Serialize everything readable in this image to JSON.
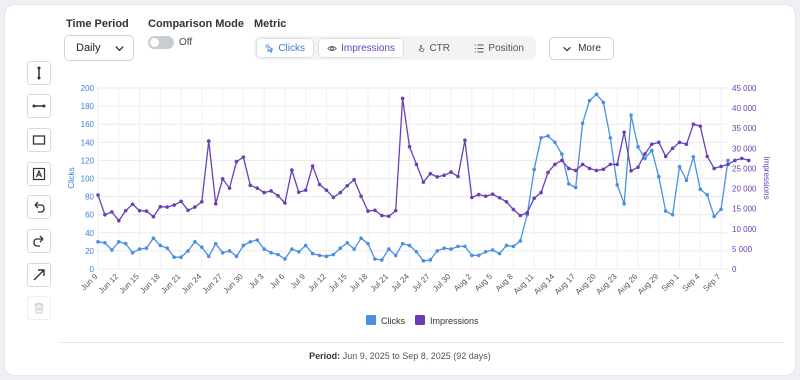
{
  "controls": {
    "time_period_label": "Time Period",
    "time_period_value": "Daily",
    "comparison_label": "Comparison Mode",
    "comparison_state": "Off",
    "metric_label": "Metric",
    "metrics": [
      {
        "label": "Clicks",
        "icon": "cursor-click-icon",
        "active": true
      },
      {
        "label": "Impressions",
        "icon": "eye-icon",
        "active": true
      },
      {
        "label": "CTR",
        "icon": "pointer-icon",
        "active": false
      },
      {
        "label": "Position",
        "icon": "list-icon",
        "active": false
      }
    ],
    "more_label": "More"
  },
  "toolbar": [
    "vertical-line-tool-icon",
    "horizontal-line-tool-icon",
    "rectangle-tool-icon",
    "text-box-tool-icon",
    "undo-icon",
    "redo-icon",
    "arrow-tool-icon",
    "trash-icon"
  ],
  "footer": {
    "period_label": "Period:",
    "period_text": "Jun 9, 2025 to Sep 8, 2025 (92 days)"
  },
  "colors": {
    "clicks": "#4a90e2",
    "impressions": "#6a3fb5",
    "accent": "#3b7dd8"
  },
  "chart_data": {
    "type": "line",
    "x_ticks": [
      "Jun 9",
      "Jun 12",
      "Jun 15",
      "Jun 18",
      "Jun 21",
      "Jun 24",
      "Jun 27",
      "Jun 30",
      "Jul 3",
      "Jul 6",
      "Jul 9",
      "Jul 12",
      "Jul 15",
      "Jul 18",
      "Jul 21",
      "Jul 24",
      "Jul 27",
      "Jul 30",
      "Aug 2",
      "Aug 5",
      "Aug 8",
      "Aug 11",
      "Aug 14",
      "Aug 17",
      "Aug 20",
      "Aug 23",
      "Aug 26",
      "Aug 29",
      "Sep 1",
      "Sep 4",
      "Sep 7"
    ],
    "y_left": {
      "label": "Clicks",
      "min": 0,
      "max": 200,
      "ticks": [
        "0",
        "20",
        "40",
        "60",
        "80",
        "100",
        "120",
        "140",
        "160",
        "180",
        "200"
      ]
    },
    "y_right": {
      "label": "Impressions",
      "min": 0,
      "max": 45000,
      "ticks": [
        "0",
        "5 000",
        "10 000",
        "15 000",
        "20 000",
        "25 000",
        "30 000",
        "35 000",
        "40 000",
        "45 000"
      ]
    },
    "series": [
      {
        "name": "Clicks",
        "axis": "left",
        "values": [
          30,
          29,
          21,
          30,
          28,
          18,
          22,
          23,
          34,
          26,
          23,
          13,
          13,
          20,
          30,
          24,
          14,
          28,
          18,
          20,
          14,
          26,
          30,
          32,
          22,
          18,
          16,
          11,
          22,
          19,
          26,
          17,
          15,
          14,
          16,
          23,
          29,
          22,
          34,
          28,
          11,
          10,
          22,
          15,
          28,
          26,
          19,
          9,
          10,
          20,
          23,
          22,
          25,
          25,
          15,
          15,
          19,
          21,
          17,
          26,
          25,
          31,
          60,
          110,
          145,
          147,
          140,
          127,
          94,
          90,
          161,
          186,
          193,
          184,
          145,
          93,
          72,
          170,
          135,
          122,
          131,
          102,
          64,
          60,
          113,
          98,
          124,
          88,
          82,
          58,
          66,
          120
        ]
      },
      {
        "name": "Impressions",
        "axis": "right",
        "values": [
          18400,
          13500,
          14200,
          12000,
          14500,
          16100,
          14500,
          14400,
          13000,
          15500,
          15400,
          15900,
          16800,
          14600,
          15400,
          16700,
          31800,
          16200,
          22400,
          20100,
          26700,
          27800,
          20800,
          20100,
          19000,
          19400,
          18200,
          16400,
          24600,
          19100,
          19600,
          25600,
          21000,
          19600,
          17800,
          19000,
          20700,
          22200,
          18100,
          14400,
          14600,
          13300,
          13100,
          14500,
          42400,
          30400,
          26000,
          21600,
          23700,
          22900,
          23300,
          24100,
          23000,
          32000,
          17800,
          18500,
          18100,
          18600,
          17700,
          16700,
          14800,
          13300,
          14000,
          17600,
          19000,
          24000,
          26000,
          27000,
          25000,
          24500,
          26000,
          25000,
          24500,
          24800,
          26000,
          26000,
          34000,
          24400,
          25300,
          28600,
          31000,
          31500,
          28000,
          30000,
          31500,
          31000,
          36000,
          35500,
          28000,
          25000,
          25500,
          26000,
          27000,
          27500,
          27000
        ]
      }
    ],
    "legend": [
      "Clicks",
      "Impressions"
    ],
    "legend_position": "bottom",
    "grid": true
  }
}
